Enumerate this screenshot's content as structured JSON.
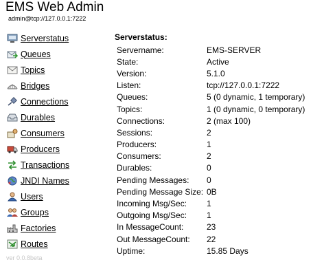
{
  "header": {
    "title": "EMS Web Admin",
    "subtitle": "admin@tcp://127.0.0.1:7222"
  },
  "sidebar": {
    "items": [
      {
        "label": "Serverstatus",
        "icon": "server-icon"
      },
      {
        "label": "Queues",
        "icon": "queue-icon"
      },
      {
        "label": "Topics",
        "icon": "envelope-icon"
      },
      {
        "label": "Bridges",
        "icon": "bridge-icon"
      },
      {
        "label": "Connections",
        "icon": "plug-icon"
      },
      {
        "label": "Durables",
        "icon": "inbox-icon"
      },
      {
        "label": "Consumers",
        "icon": "consumer-icon"
      },
      {
        "label": "Producers",
        "icon": "truck-icon"
      },
      {
        "label": "Transactions",
        "icon": "arrows-icon"
      },
      {
        "label": "JNDI Names",
        "icon": "globe-icon"
      },
      {
        "label": "Users",
        "icon": "user-icon"
      },
      {
        "label": "Groups",
        "icon": "group-icon"
      },
      {
        "label": "Factories",
        "icon": "factory-icon"
      },
      {
        "label": "Routes",
        "icon": "routes-icon"
      }
    ],
    "version": "ver 0.0.8beta"
  },
  "status": {
    "heading": "Serverstatus:",
    "rows": [
      {
        "key": "Servername:",
        "value": "EMS-SERVER"
      },
      {
        "key": "State:",
        "value": "Active"
      },
      {
        "key": "Version:",
        "value": "5.1.0"
      },
      {
        "key": "Listen:",
        "value": "tcp://127.0.0.1:7222"
      },
      {
        "key": "Queues:",
        "value": "5 (0 dynamic, 1 temporary)"
      },
      {
        "key": "Topics:",
        "value": "1 (0 dynamic, 0 temporary)"
      },
      {
        "key": "Connections:",
        "value": "2 (max 100)"
      },
      {
        "key": "Sessions:",
        "value": "2"
      },
      {
        "key": "Producers:",
        "value": "1"
      },
      {
        "key": "Consumers:",
        "value": "2"
      },
      {
        "key": "Durables:",
        "value": "0"
      },
      {
        "key": "Pending Messages:",
        "value": "0"
      },
      {
        "key": "Pending Message Size:",
        "value": "0B"
      },
      {
        "key": "Incoming Msg/Sec:",
        "value": "1"
      },
      {
        "key": "Outgoing Msg/Sec:",
        "value": "1"
      },
      {
        "key": "In MessageCount:",
        "value": "23"
      },
      {
        "key": "Out MessageCount:",
        "value": "22"
      },
      {
        "key": "Uptime:",
        "value": "15.85 Days"
      }
    ]
  }
}
